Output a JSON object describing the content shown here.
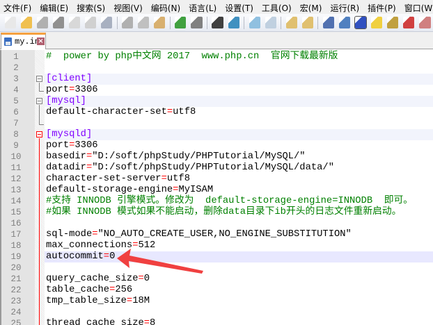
{
  "menu": [
    "文件(F)",
    "编辑(E)",
    "搜索(S)",
    "视图(V)",
    "编码(N)",
    "语言(L)",
    "设置(T)",
    "工具(O)",
    "宏(M)",
    "运行(R)",
    "插件(P)",
    "窗口(W"
  ],
  "toolbar": [
    {
      "icon": "new-file-icon",
      "color": "#e8e8e8"
    },
    {
      "icon": "open-folder-icon",
      "color": "#f0c050"
    },
    {
      "icon": "save-icon",
      "color": "#b0b0b0"
    },
    {
      "icon": "save-all-icon",
      "color": "#909090"
    },
    {
      "icon": "close-icon",
      "color": "#d8d8d8"
    },
    {
      "icon": "close-all-icon",
      "color": "#d0d0d0"
    },
    {
      "icon": "print-icon",
      "color": "#a8b0c0"
    },
    "sep",
    {
      "icon": "cut-icon",
      "color": "#b0b0b0"
    },
    {
      "icon": "copy-icon",
      "color": "#c0c0c0"
    },
    {
      "icon": "paste-icon",
      "color": "#d8b070"
    },
    "sep",
    {
      "icon": "undo-icon",
      "color": "#40a040"
    },
    {
      "icon": "redo-icon",
      "color": "#808080"
    },
    "sep",
    {
      "icon": "find-icon",
      "color": "#404040"
    },
    {
      "icon": "replace-icon",
      "color": "#4090c0"
    },
    "sep",
    {
      "icon": "zoom-in-icon",
      "color": "#90c0e0"
    },
    {
      "icon": "zoom-out-icon",
      "color": "#c0d0e0"
    },
    "sep",
    {
      "icon": "sync-vertical-icon",
      "color": "#e0c070"
    },
    {
      "icon": "sync-horizontal-icon",
      "color": "#e0c070"
    },
    "sep",
    {
      "icon": "word-wrap-icon",
      "color": "#5070b0"
    },
    {
      "icon": "show-all-chars-icon",
      "color": "#5080c0"
    },
    {
      "icon": "indent-guide-icon",
      "color": "#3050c0",
      "active": true
    },
    {
      "icon": "udl-icon",
      "color": "#f0d040"
    },
    {
      "icon": "doc-map-icon",
      "color": "#c0a040"
    },
    {
      "icon": "function-list-icon",
      "color": "#d04040"
    },
    {
      "icon": "folder-workspace-icon",
      "color": "#d08080"
    }
  ],
  "tab": {
    "label": "my.ini"
  },
  "colors": {
    "comment": "#008000",
    "section": "#8000ff",
    "operator": "#ff0000",
    "current_line": "#e8e8ff",
    "fold_active": "#ff0000",
    "arrow": "#f04040"
  },
  "lines": [
    {
      "n": "1",
      "text": "#  power by php中文网 2017  www.php.cn  官网下载最新版",
      "kind": "comment"
    },
    {
      "n": "2",
      "text": "",
      "kind": "blank"
    },
    {
      "n": "3",
      "text": "[client]",
      "kind": "section"
    },
    {
      "n": "4",
      "text": "port=3306",
      "kind": "kv"
    },
    {
      "n": "5",
      "text": "[mysql]",
      "kind": "section"
    },
    {
      "n": "6",
      "text": "default-character-set=utf8",
      "kind": "kv"
    },
    {
      "n": "7",
      "text": "",
      "kind": "blank"
    },
    {
      "n": "8",
      "text": "[mysqld]",
      "kind": "section"
    },
    {
      "n": "9",
      "text": "port=3306",
      "kind": "kv"
    },
    {
      "n": "10",
      "text": "basedir=\"D:/soft/phpStudy/PHPTutorial/MySQL/\"",
      "kind": "kv"
    },
    {
      "n": "11",
      "text": "datadir=\"D:/soft/phpStudy/PHPTutorial/MySQL/data/\"",
      "kind": "kv"
    },
    {
      "n": "12",
      "text": "character-set-server=utf8",
      "kind": "kv"
    },
    {
      "n": "13",
      "text": "default-storage-engine=MyISAM",
      "kind": "kv"
    },
    {
      "n": "14",
      "text": "#支持 INNODB 引擎模式。修改为  default-storage-engine=INNODB  即可。",
      "kind": "comment"
    },
    {
      "n": "15",
      "text": "#如果 INNODB 模式如果不能启动，删除data目录下ib开头的日志文件重新启动。",
      "kind": "comment"
    },
    {
      "n": "16",
      "text": "",
      "kind": "blank"
    },
    {
      "n": "17",
      "text": "sql-mode=\"NO_AUTO_CREATE_USER,NO_ENGINE_SUBSTITUTION\"",
      "kind": "kv"
    },
    {
      "n": "18",
      "text": "max_connections=512",
      "kind": "kv"
    },
    {
      "n": "19",
      "text": "autocommit=0",
      "kind": "kv",
      "current": true
    },
    {
      "n": "20",
      "text": "",
      "kind": "blank"
    },
    {
      "n": "21",
      "text": "query_cache_size=0",
      "kind": "kv"
    },
    {
      "n": "22",
      "text": "table_cache=256",
      "kind": "kv"
    },
    {
      "n": "23",
      "text": "tmp_table_size=18M",
      "kind": "kv"
    },
    {
      "n": "24",
      "text": "",
      "kind": "blank"
    },
    {
      "n": "25",
      "text": "thread_cache_size=8",
      "kind": "kv"
    }
  ]
}
